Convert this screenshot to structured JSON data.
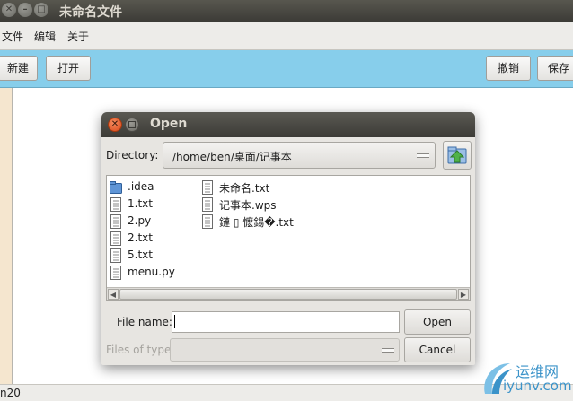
{
  "window": {
    "title": "未命名文件"
  },
  "menubar": {
    "items": [
      "文件",
      "编辑",
      "关于"
    ]
  },
  "toolbar": {
    "new_label": "新建",
    "open_label": "打开",
    "undo_label": "撤销",
    "save_label": "保存"
  },
  "status": {
    "text": "n20"
  },
  "dialog": {
    "title": "Open",
    "directory_label": "Directory:",
    "directory_value": "/home/ben/桌面/记事本",
    "files_col1": [
      {
        "name": ".idea",
        "icon": "folder-icon"
      },
      {
        "name": "1.txt",
        "icon": "file-icon"
      },
      {
        "name": "2.py",
        "icon": "file-icon"
      },
      {
        "name": "2.txt",
        "icon": "file-icon"
      },
      {
        "name": "5.txt",
        "icon": "file-icon"
      },
      {
        "name": "menu.py",
        "icon": "file-icon"
      }
    ],
    "files_col2": [
      {
        "name": "未命名.txt",
        "icon": "file-icon"
      },
      {
        "name": "记事本.wps",
        "icon": "file-icon"
      },
      {
        "name": "鏈 ▯ 懡鍚�.txt",
        "icon": "file-icon"
      }
    ],
    "file_name_label": "File name:",
    "file_name_value": "",
    "files_of_type_label": "Files of type:",
    "files_of_type_value": "",
    "open_label": "Open",
    "cancel_label": "Cancel"
  },
  "watermark": {
    "cn": "运维网",
    "en": "iyunv.com"
  },
  "colors": {
    "toolbar": "#87ceeb",
    "editor": "#ffffff",
    "folder": "#5f95d6"
  }
}
